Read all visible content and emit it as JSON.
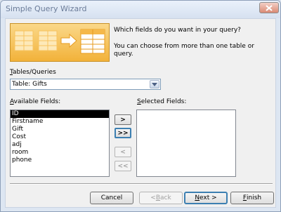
{
  "window": {
    "title": "Simple Query Wizard"
  },
  "intro": {
    "question": "Which fields do you want in your query?",
    "hint": "You can choose from more than one table or query."
  },
  "tables_queries": {
    "label_mnemonic": "T",
    "label_rest": "ables/Queries",
    "selected": "Table: Gifts"
  },
  "available_fields": {
    "label_mnemonic": "A",
    "label_rest": "vailable Fields:",
    "items": [
      "ID",
      "Firstname",
      "Gift",
      "Cost",
      "adj",
      "room",
      "phone"
    ],
    "selected_index": 0
  },
  "selected_fields": {
    "label_mnemonic": "S",
    "label_rest": "elected Fields:",
    "items": []
  },
  "move_buttons": {
    "add_one": ">",
    "add_all": ">>",
    "remove_one": "<",
    "remove_all": "<<"
  },
  "footer": {
    "cancel": "Cancel",
    "back_mnemonic": "B",
    "back_prefix": "< ",
    "back_rest": "ack",
    "next_mnemonic": "N",
    "next_rest": "ext >",
    "finish_mnemonic": "F",
    "finish_rest": "inish"
  },
  "colors": {
    "banner": "#f2b23a",
    "selection": "#000000",
    "default_button_border": "#3c7fb1"
  }
}
